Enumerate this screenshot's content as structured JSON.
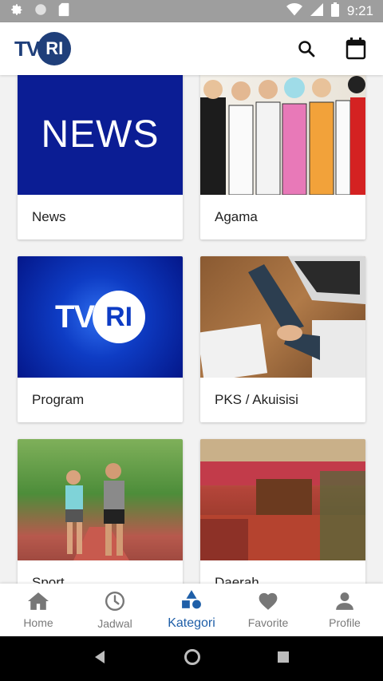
{
  "status_bar": {
    "time": "9:21",
    "icons": [
      "gear-icon",
      "circle-icon",
      "sd-card-icon",
      "wifi-icon",
      "signal-icon",
      "battery-icon"
    ]
  },
  "app_bar": {
    "logo_tv": "TV",
    "logo_ri": "RI",
    "icons": [
      "search-icon",
      "calendar-icon"
    ]
  },
  "categories": [
    {
      "label": "News",
      "thumb_text": "NEWS"
    },
    {
      "label": "Agama"
    },
    {
      "label": "Program",
      "thumb_logo_tv": "TV",
      "thumb_logo_ri": "RI"
    },
    {
      "label": "PKS / Akuisisi"
    },
    {
      "label": "Sport"
    },
    {
      "label": "Daerah"
    }
  ],
  "bottom_nav": {
    "items": [
      {
        "label": "Home",
        "icon": "home-icon"
      },
      {
        "label": "Jadwal",
        "icon": "clock-icon"
      },
      {
        "label": "Kategori",
        "icon": "shapes-icon",
        "active": true
      },
      {
        "label": "Favorite",
        "icon": "heart-icon"
      },
      {
        "label": "Profile",
        "icon": "person-icon"
      }
    ]
  },
  "colors": {
    "brand": "#1f3f7a",
    "active_tab": "#1f5fa8",
    "status_bar": "#9e9e9e"
  }
}
